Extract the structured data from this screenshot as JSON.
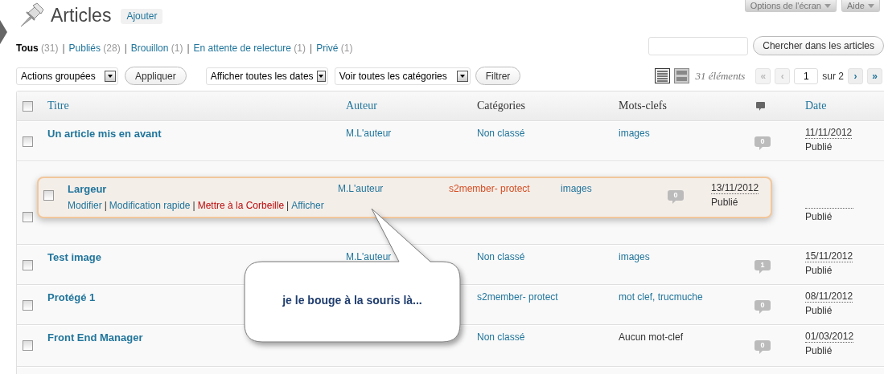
{
  "screen_options": [
    {
      "label": "Options de l'écran"
    },
    {
      "label": "Aide"
    }
  ],
  "page": {
    "title": "Articles",
    "add_button": "Ajouter"
  },
  "filters": [
    {
      "label": "Tous",
      "count": "(31)",
      "selected": true,
      "separator": "|"
    },
    {
      "label": "Publiés",
      "count": "(28)",
      "selected": false,
      "separator": "|"
    },
    {
      "label": "Brouillon",
      "count": "(1)",
      "selected": false,
      "separator": "|"
    },
    {
      "label": "En attente de relecture",
      "count": "(1)",
      "selected": false,
      "separator": "|"
    },
    {
      "label": "Privé",
      "count": "(1)",
      "selected": false
    }
  ],
  "search": {
    "button": "Chercher dans les articles"
  },
  "toolbar": {
    "bulk_actions": "Actions groupées",
    "apply": "Appliquer",
    "date_filter": "Afficher toutes les dates",
    "category_filter": "Voir toutes les catégories",
    "filter_button": "Filtrer"
  },
  "view_modes": [
    {
      "kind": "list",
      "selected": true
    },
    {
      "kind": "excerpt",
      "selected": false
    }
  ],
  "pagination": {
    "count": "31 éléments",
    "page": "1",
    "total": "sur 2",
    "buttons": [
      {
        "label": "«",
        "disabled": true
      },
      {
        "label": "‹",
        "disabled": true
      },
      {
        "label": "›",
        "disabled": false
      },
      {
        "label": "»",
        "disabled": false
      }
    ]
  },
  "table": {
    "columns": [
      {
        "label": "Titre",
        "sortable": true
      },
      {
        "label": "Auteur",
        "sortable": true
      },
      {
        "label": "Catégories",
        "sortable": false
      },
      {
        "label": "Mots-clefs",
        "sortable": false
      },
      {
        "kind": "comments"
      },
      {
        "label": "Date",
        "sortable": true
      }
    ],
    "select_all_checked": false,
    "rows": [
      {
        "kind": "post",
        "checked": false,
        "title": "Un article mis en avant",
        "author": "M.L'auteur",
        "categories": "Non classé",
        "tags": "images",
        "tags_linked": true,
        "comments": "0",
        "date": "11/11/2012",
        "status": "Publié"
      },
      {
        "kind": "placeholder",
        "checked": false,
        "status": "Publié"
      },
      {
        "kind": "post",
        "checked": false,
        "title": "Test image",
        "author": "M.L'auteur",
        "categories": "Non classé",
        "tags": "images",
        "tags_linked": true,
        "comments": "1",
        "date": "15/11/2012",
        "status": "Publié"
      },
      {
        "kind": "post",
        "checked": false,
        "title": "Protégé 1",
        "categories": "s2member- protect",
        "tags": "mot clef, trucmuche",
        "tags_linked": true,
        "comments": "0",
        "date": "08/11/2012",
        "status": "Publié"
      },
      {
        "kind": "post",
        "checked": false,
        "title": "Front End Manager",
        "categories": "Non classé",
        "tags": "Aucun mot-clef",
        "tags_linked": false,
        "comments": "0",
        "date": "01/03/2012",
        "status": "Publié"
      }
    ],
    "dragged_row": {
      "checked": false,
      "title": "Largeur",
      "author": "M.L'auteur",
      "categories": "s2member- protect",
      "tags": "images",
      "comments": "0",
      "date": "13/11/2012",
      "status": "Publié",
      "actions": [
        {
          "label": "Modifier",
          "kind": "normal",
          "separator": "|"
        },
        {
          "label": "Modification rapide",
          "kind": "normal",
          "separator": "|"
        },
        {
          "label": "Mettre à la Corbeille",
          "kind": "delete",
          "separator": "|"
        },
        {
          "label": "Afficher",
          "kind": "normal"
        }
      ]
    }
  },
  "callout": {
    "text": "je le bouge à la souris là..."
  }
}
